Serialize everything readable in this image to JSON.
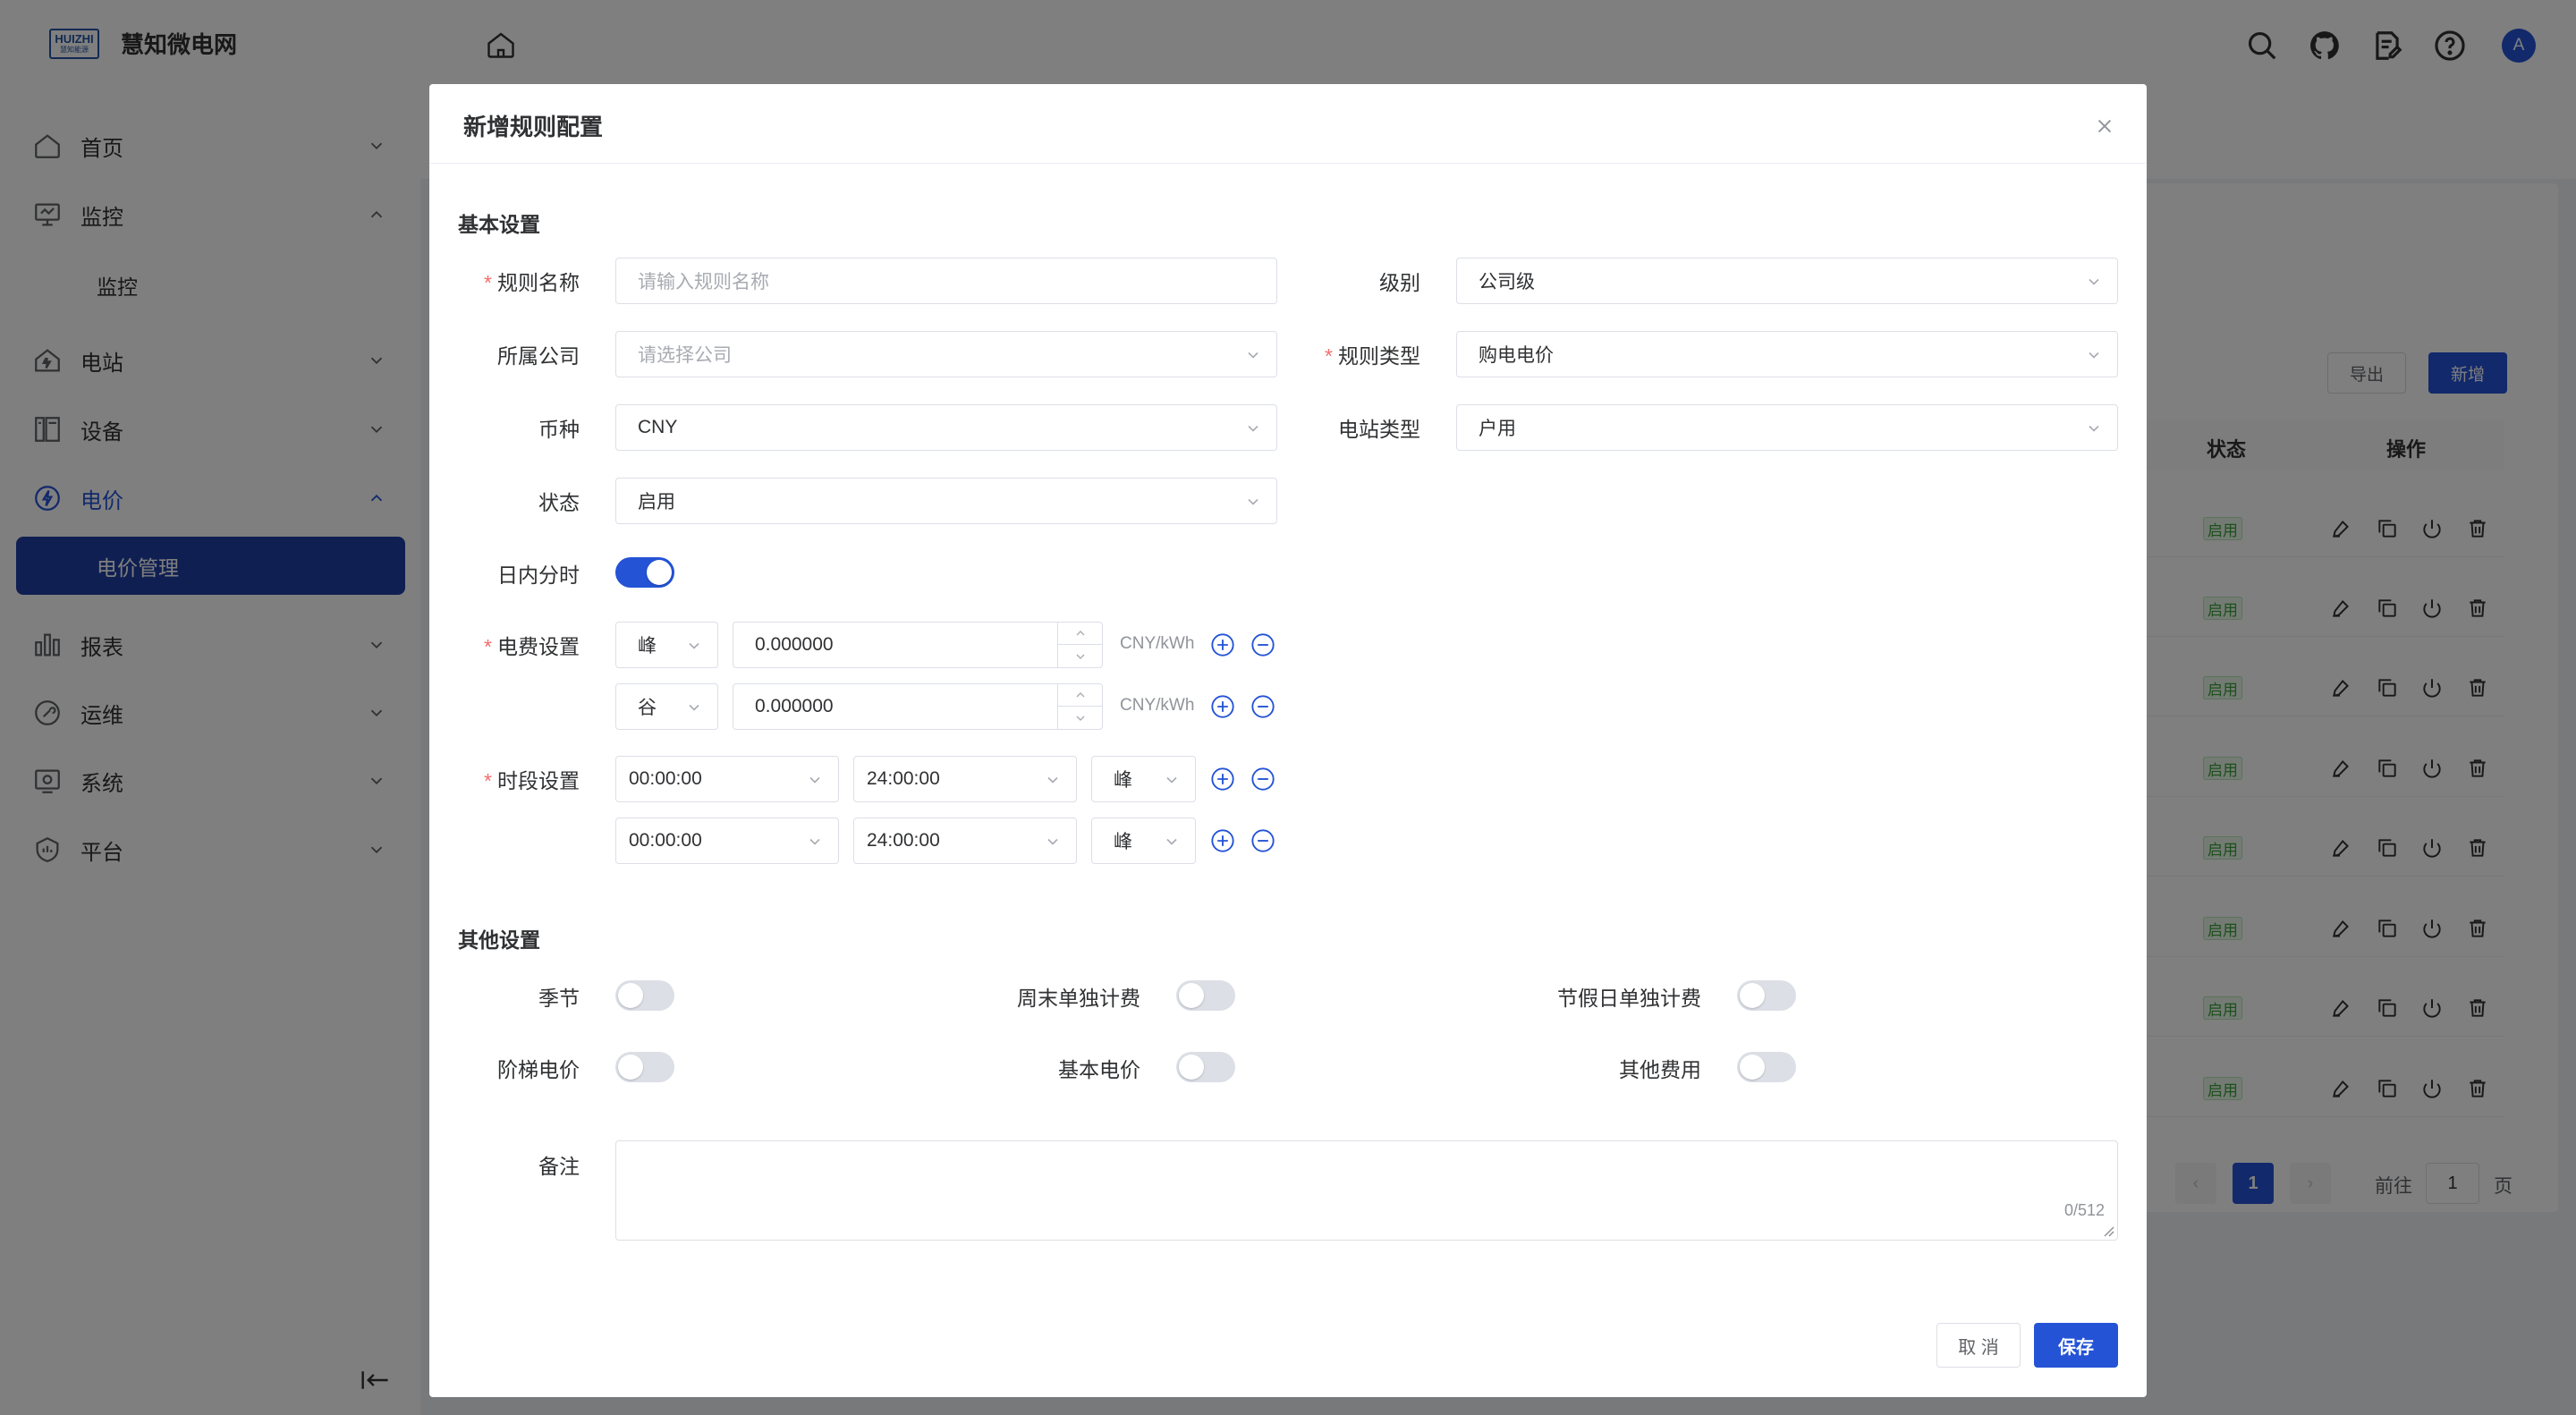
{
  "app": {
    "logo_line1": "HUIZHI",
    "logo_line2": "慧知能源",
    "brand": "慧知微电网",
    "avatar_letter": "A",
    "accent_color": "#2453d6"
  },
  "sidebar": {
    "items": [
      {
        "label": "首页",
        "icon": "home-icon"
      },
      {
        "label": "监控",
        "icon": "monitor-icon",
        "expanded": true,
        "children": [
          "监控"
        ]
      },
      {
        "label": "电站",
        "icon": "station-icon"
      },
      {
        "label": "设备",
        "icon": "device-icon"
      },
      {
        "label": "电价",
        "icon": "price-icon",
        "expanded": true,
        "active": true,
        "children": [
          "电价管理"
        ]
      },
      {
        "label": "报表",
        "icon": "report-icon"
      },
      {
        "label": "运维",
        "icon": "maintenance-icon"
      },
      {
        "label": "系统",
        "icon": "system-icon"
      },
      {
        "label": "平台",
        "icon": "platform-icon"
      }
    ]
  },
  "background": {
    "export_label": "导出",
    "add_label": "新增",
    "col_status": "状态",
    "col_action": "操作",
    "status_tag": "启用",
    "page_current": "1",
    "goto_label": "前往",
    "goto_value": "1",
    "page_unit": "页"
  },
  "dialog": {
    "title": "新增规则配置",
    "basic_section": "基本设置",
    "other_section": "其他设置",
    "fields": {
      "rule_name": {
        "label": "规则名称",
        "placeholder": "请输入规则名称",
        "value": ""
      },
      "level": {
        "label": "级别",
        "value": "公司级"
      },
      "company": {
        "label": "所属公司",
        "placeholder": "请选择公司",
        "value": ""
      },
      "rule_type": {
        "label": "规则类型",
        "value": "购电电价"
      },
      "currency": {
        "label": "币种",
        "value": "CNY"
      },
      "station_type": {
        "label": "电站类型",
        "value": "户用"
      },
      "status": {
        "label": "状态",
        "value": "启用"
      },
      "intraday": {
        "label": "日内分时",
        "on": true
      }
    },
    "fee": {
      "label": "电费设置",
      "unit": "CNY/kWh",
      "rows": [
        {
          "period": "峰",
          "price": "0.000000"
        },
        {
          "period": "谷",
          "price": "0.000000"
        }
      ]
    },
    "time": {
      "label": "时段设置",
      "rows": [
        {
          "start": "00:00:00",
          "end": "24:00:00",
          "period": "峰"
        },
        {
          "start": "00:00:00",
          "end": "24:00:00",
          "period": "峰"
        }
      ]
    },
    "switches": [
      {
        "label": "季节",
        "on": false
      },
      {
        "label": "周末单独计费",
        "on": false
      },
      {
        "label": "节假日单独计费",
        "on": false
      },
      {
        "label": "阶梯电价",
        "on": false
      },
      {
        "label": "基本电价",
        "on": false
      },
      {
        "label": "其他费用",
        "on": false
      }
    ],
    "remark": {
      "label": "备注",
      "counter": "0/512"
    },
    "cancel_label": "取 消",
    "save_label": "保存"
  }
}
